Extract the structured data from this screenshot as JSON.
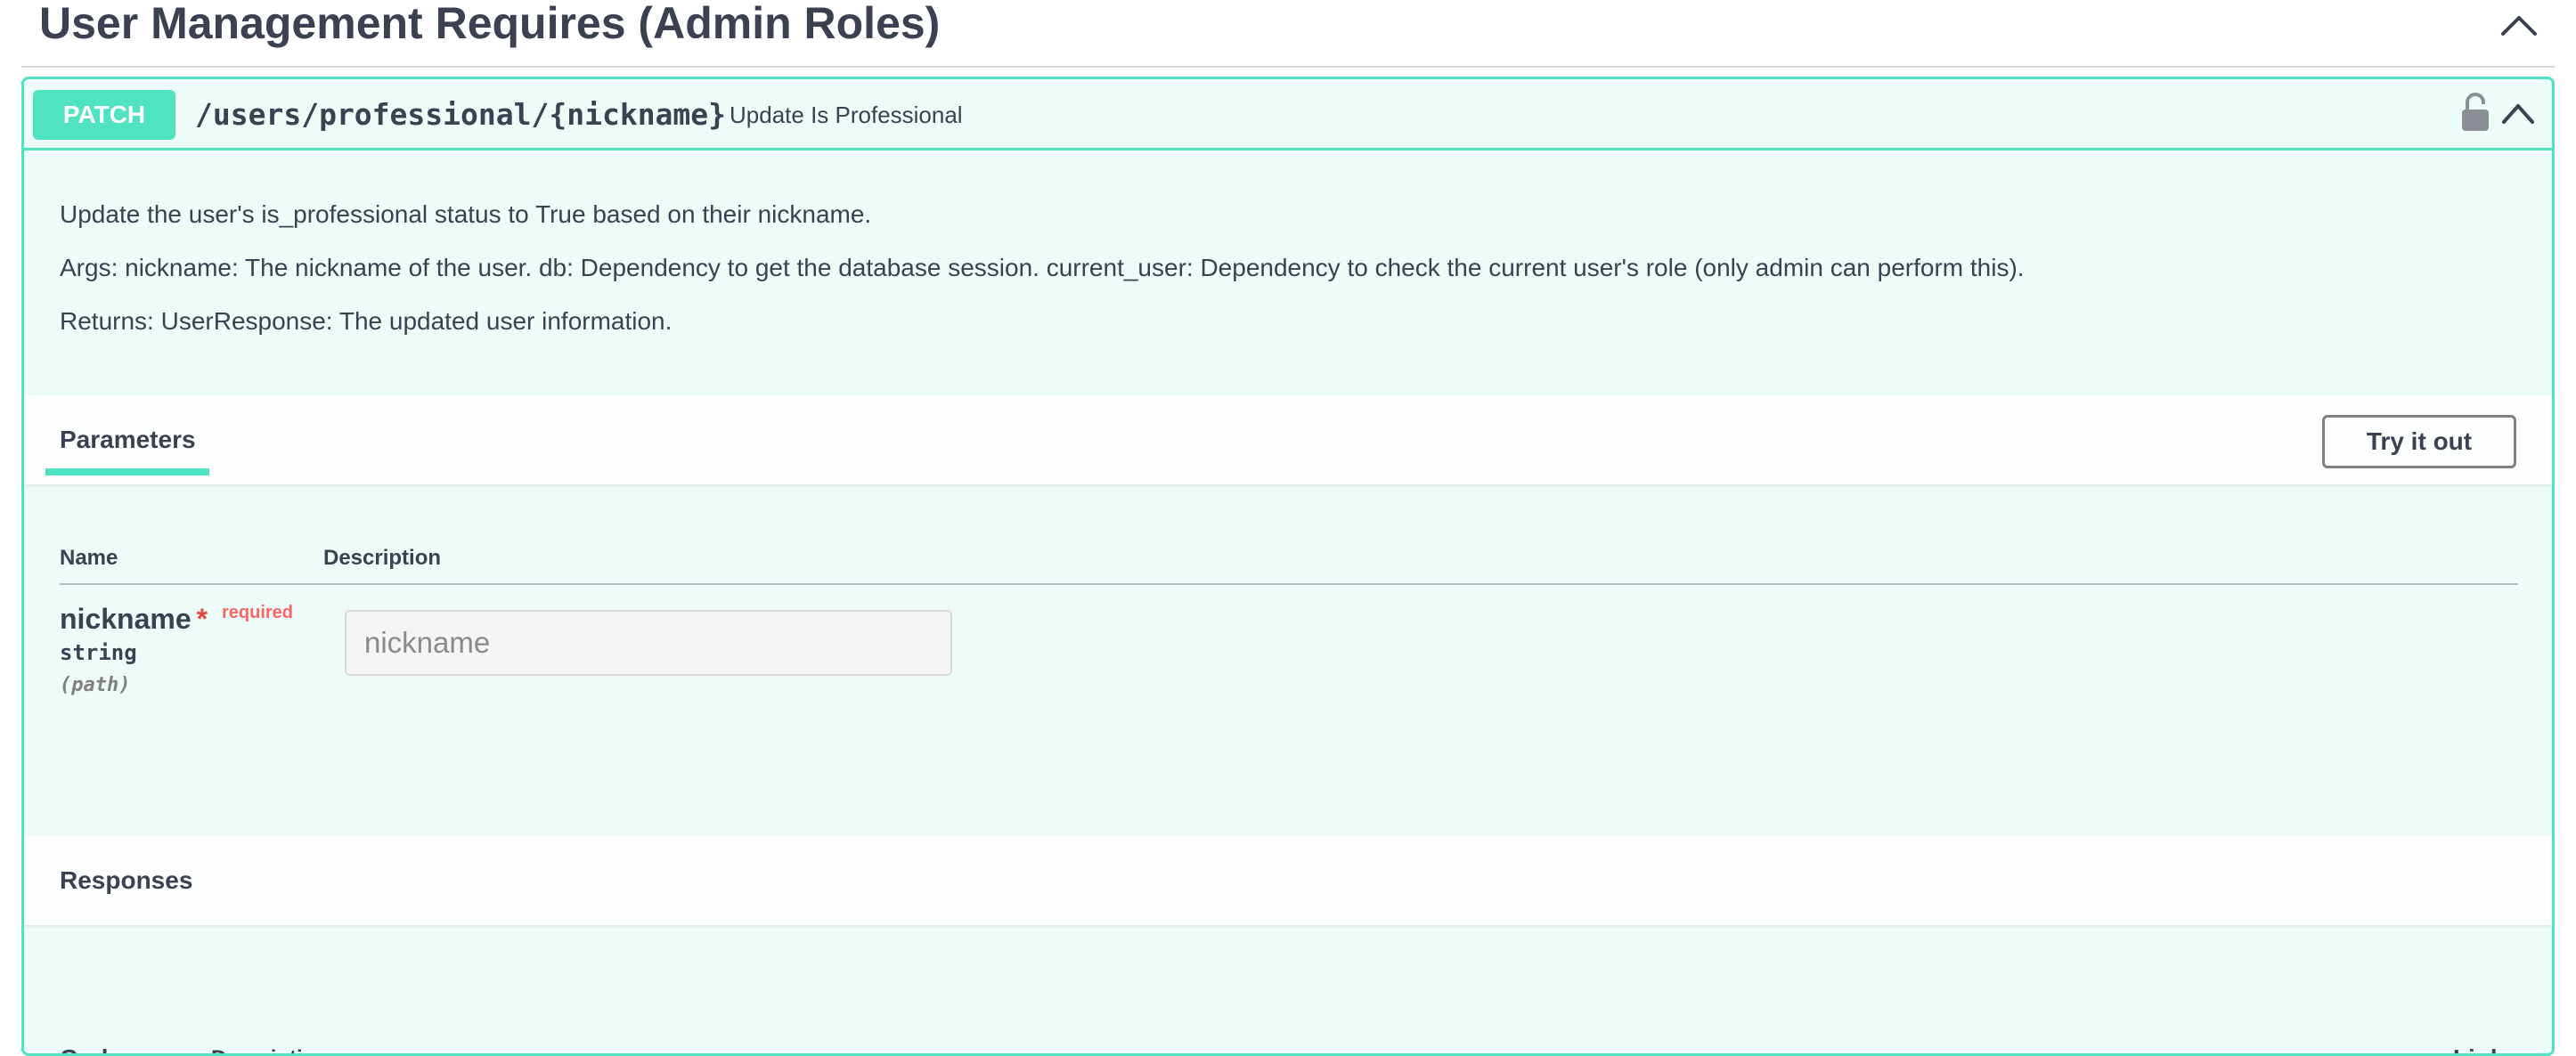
{
  "section": {
    "title": "User Management Requires (Admin Roles)"
  },
  "operation": {
    "method": "PATCH",
    "path": "/users/professional/{nickname}",
    "summary": "Update Is Professional",
    "description": [
      "Update the user's is_professional status to True based on their nickname.",
      "Args: nickname: The nickname of the user. db: Dependency to get the database session. current_user: Dependency to check the current user's role (only admin can perform this).",
      "Returns: UserResponse: The updated user information."
    ]
  },
  "parameters": {
    "tab_label": "Parameters",
    "try_button": "Try it out",
    "headers": {
      "name": "Name",
      "description": "Description"
    },
    "items": [
      {
        "name": "nickname",
        "required_star": "*",
        "required_label": "required",
        "type": "string",
        "in": "(path)",
        "placeholder": "nickname"
      }
    ]
  },
  "responses": {
    "tab_label": "Responses",
    "headers": {
      "code": "Code",
      "description": "Description",
      "links": "Links"
    }
  },
  "colors": {
    "method_patch": "#50e3c2",
    "required": "#e6493b",
    "text": "#3b4151"
  },
  "icons": {
    "section_toggle": "chevron-up-icon",
    "lock": "lock-unlocked-icon",
    "op_toggle": "chevron-up-icon"
  }
}
